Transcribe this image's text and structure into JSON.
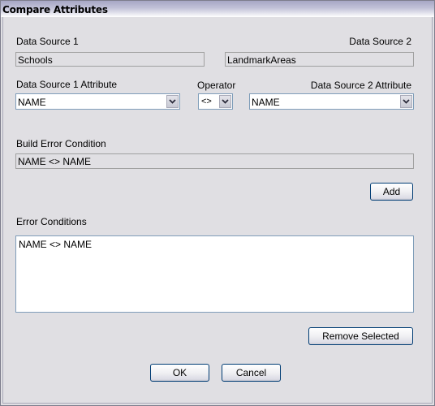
{
  "window": {
    "title": "Compare Attributes"
  },
  "data_sources": {
    "source1_label": "Data Source 1",
    "source1_value": "Schools",
    "source2_label": "Data Source 2",
    "source2_value": "LandmarkAreas"
  },
  "attributes": {
    "source1_attr_label": "Data Source 1 Attribute",
    "source1_attr_selected": "NAME",
    "operator_label": "Operator",
    "operator_selected": "<>",
    "source2_attr_label": "Data Source 2 Attribute",
    "source2_attr_selected": "NAME",
    "dropdown_icon": "chevron-down-icon"
  },
  "build": {
    "label": "Build Error Condition",
    "value": "NAME <> NAME",
    "add_button": "Add"
  },
  "conditions": {
    "label": "Error Conditions",
    "items": [
      "NAME <> NAME"
    ],
    "remove_button": "Remove Selected"
  },
  "footer": {
    "ok_button": "OK",
    "cancel_button": "Cancel"
  }
}
